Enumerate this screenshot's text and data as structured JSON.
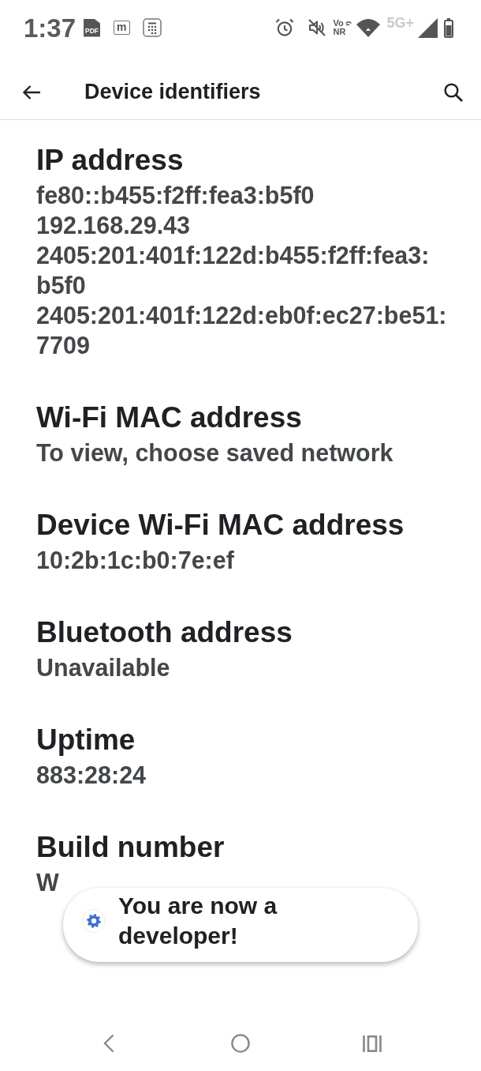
{
  "status_bar": {
    "time": "1:37",
    "pdf_badge": "PDF",
    "app_badge": "m",
    "network_label_top": "Vo",
    "network_label_bottom": "NR",
    "mobile_data": "5G+"
  },
  "toolbar": {
    "title": "Device identifiers"
  },
  "items": [
    {
      "title": "IP address",
      "values": [
        "fe80::b455:f2ff:fea3:b5f0",
        "192.168.29.43",
        "2405:201:401f:122d:b455:f2ff:fea3:b5f0",
        "2405:201:401f:122d:eb0f:ec27:be51:7709"
      ]
    },
    {
      "title": "Wi-Fi MAC address",
      "values": [
        "To view, choose saved network"
      ]
    },
    {
      "title": "Device Wi-Fi MAC address",
      "values": [
        "10:2b:1c:b0:7e:ef"
      ]
    },
    {
      "title": "Bluetooth address",
      "values": [
        "Unavailable"
      ]
    },
    {
      "title": "Uptime",
      "values": [
        "883:28:24"
      ]
    },
    {
      "title": "Build number",
      "values": [
        "W"
      ]
    }
  ],
  "toast": {
    "message": "You are now a developer!"
  }
}
